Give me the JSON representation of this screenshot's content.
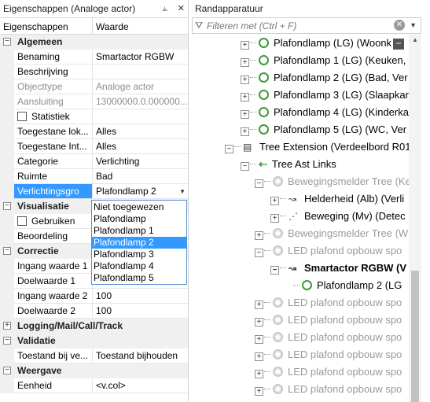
{
  "left_panel": {
    "title": "Eigenschappen (Analoge actor)",
    "pin_glyph": "⫨",
    "close_glyph": "✕",
    "col_property": "Eigenschappen",
    "col_value": "Waarde",
    "categories": {
      "algemeen": "Algemeen",
      "visualisatie": "Visualisatie",
      "correctie": "Correctie",
      "logging": "Logging/Mail/Call/Track",
      "validatie": "Validatie",
      "weergave": "Weergave"
    },
    "rows": {
      "benaming": {
        "k": "Benaming",
        "v": "Smartactor RGBW"
      },
      "beschrijving": {
        "k": "Beschrijving",
        "v": ""
      },
      "objecttype": {
        "k": "Objecttype",
        "v": "Analoge actor"
      },
      "aansluiting": {
        "k": "Aansluiting",
        "v": "13000000.0.000000..."
      },
      "statistiek": {
        "k": "Statistiek"
      },
      "toegestane_lok": {
        "k": "Toegestane lok...",
        "v": "Alles"
      },
      "toegestane_int": {
        "k": "Toegestane Int...",
        "v": "Alles"
      },
      "categorie": {
        "k": "Categorie",
        "v": "Verlichting"
      },
      "ruimte": {
        "k": "Ruimte",
        "v": "Bad"
      },
      "verlichtingsgro": {
        "k": "Verlichtingsgro",
        "v": "Plafondlamp 2"
      },
      "gebruiken": {
        "k": "Gebruiken"
      },
      "beoordeling": {
        "k": "Beoordeling",
        "v": ""
      },
      "ingang1": {
        "k": "Ingang waarde 1",
        "v": ""
      },
      "doel1": {
        "k": "Doelwaarde 1",
        "v": ""
      },
      "ingang2": {
        "k": "Ingang waarde 2",
        "v": "100"
      },
      "doel2": {
        "k": "Doelwaarde 2",
        "v": "100"
      },
      "toestand": {
        "k": "Toestand bij ve...",
        "v": "Toestand bijhouden"
      },
      "eenheid": {
        "k": "Eenheid",
        "v": "<v.col>"
      }
    },
    "dropdown_options": [
      "Niet toegewezen",
      "Plafondlamp",
      "Plafondlamp 1",
      "Plafondlamp 2",
      "Plafondlamp 3",
      "Plafondlamp 4",
      "Plafondlamp 5"
    ]
  },
  "right_panel": {
    "title": "Randapparatuur",
    "filter_placeholder": "Filteren met (Ctrl + F)",
    "tree": {
      "n1": "Plafondlamp (LG) (Woonk",
      "n2": "Plafondlamp 1 (LG) (Keuken,",
      "n3": "Plafondlamp 2 (LG) (Bad, Ver",
      "n4": "Plafondlamp 3 (LG) (Slaapkar",
      "n5": "Plafondlamp 4 (LG) (Kinderka",
      "n6": "Plafondlamp 5 (LG) (WC, Ver",
      "n7": "Tree Extension (Verdeelbord R01",
      "n8": "Tree Ast Links",
      "n9": "Bewegingsmelder Tree (Ke",
      "n10": "Helderheid (Alb) (Verli",
      "n11": "Beweging (Mv) (Detec",
      "n12": "Bewegingsmelder Tree (W",
      "n13": "LED plafond opbouw spo",
      "n14": "Smartactor RGBW (V",
      "n15": "Plafondlamp 2 (LG",
      "n16": "LED plafond opbouw spo",
      "n17": "LED plafond opbouw spo",
      "n18": "LED plafond opbouw spo",
      "n19": "LED plafond opbouw spo",
      "n20": "LED plafond opbouw spo",
      "n21": "LED plafond opbouw spo",
      "n22": "LED plafond opbouw spo"
    }
  },
  "colors": {
    "selection": "#3399ff",
    "lamp_green": "#3c9a3c",
    "category_bg": "#f0f0f0"
  }
}
